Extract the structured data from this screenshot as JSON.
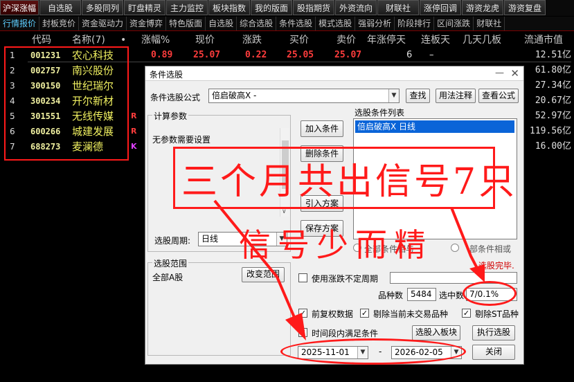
{
  "topbar": [
    "沪深涨幅",
    "自选股",
    "多股同列",
    "盯盘精灵",
    "主力监控",
    "板块指数",
    "我的版面",
    "股指期货",
    "外资流向",
    "财联社",
    "涨停回调",
    "游资龙虎",
    "游资复盘"
  ],
  "tabs": [
    "行情报价",
    "封板竞价",
    "资金驱动力",
    "资金博弈",
    "特色版面",
    "自选股",
    "综合选股",
    "条件选股",
    "模式选股",
    "强弱分析",
    "阶段排行",
    "区间涨跌",
    "财联社"
  ],
  "columns": {
    "code": "代码",
    "name": "名称(7)",
    "dot": "•",
    "chg": "涨幅%",
    "price": "现价",
    "diff": "涨跌",
    "buy": "买价",
    "sell": "卖价",
    "year_limit": "年涨停天",
    "consec": "连板天",
    "board": "几天几板",
    "mktval": "流通市值"
  },
  "stocks": [
    {
      "idx": "1",
      "code": "001231",
      "name": "农心科技",
      "chg": "0.89",
      "price": "25.07",
      "diff": "0.22",
      "buy": "25.05",
      "sell": "25.07",
      "year_limit": "6",
      "consec": "–",
      "mktval": "12.51亿",
      "tag": ""
    },
    {
      "idx": "2",
      "code": "002757",
      "name": "南兴股份",
      "mktval": "61.80亿",
      "tag": ""
    },
    {
      "idx": "3",
      "code": "300150",
      "name": "世纪瑞尔",
      "mktval": "27.34亿",
      "tag": ""
    },
    {
      "idx": "4",
      "code": "300234",
      "name": "开尔新材",
      "mktval": "20.67亿",
      "tag": ""
    },
    {
      "idx": "5",
      "code": "301551",
      "name": "无线传媒",
      "mktval": "52.97亿",
      "tag": "R"
    },
    {
      "idx": "6",
      "code": "600266",
      "name": "城建发展",
      "mktval": "119.56亿",
      "tag": "R"
    },
    {
      "idx": "7",
      "code": "688273",
      "name": "麦澜德",
      "mktval": "16.00亿",
      "tag": "K"
    }
  ],
  "dialog": {
    "title": "条件选股",
    "formula_label": "条件选股公式",
    "formula_value": "倍启破高X  -",
    "btn_find": "查找",
    "btn_usage": "用法注释",
    "btn_view": "查看公式",
    "params_group": "计算参数",
    "params_text": "无参数需要设置",
    "btn_add": "加入条件",
    "btn_delete": "删除条件",
    "btn_load": "引入方案",
    "btn_save": "保存方案",
    "list_label": "选股条件列表",
    "list_item": "倍启破高X  日线",
    "period_label": "选股周期:",
    "period_value": "日线",
    "radio_and": "全部条件相与",
    "radio_or": "部条件相或",
    "range_group": "选股范围",
    "range_value": "全部A股",
    "btn_range": "改变范围",
    "status": "选股完毕.",
    "chk_period": "使用涨跌不定周期",
    "count_label": "品种数",
    "count_value": "5484",
    "selected_label": "选中数",
    "selected_value": "7/0.1%",
    "chk_fq": "前复权数据",
    "chk_notrade": "剔除当前未交易品种",
    "chk_st": "剔除ST品种",
    "chk_time": "时间段内满足条件",
    "btn_toboard": "选股入板块",
    "btn_exec": "执行选股",
    "date_from": "2025-11-01",
    "date_sep": "-",
    "date_to": "2026-02-05",
    "btn_close": "关闭"
  },
  "annotation": {
    "headline": "三个月共出信号7只",
    "sub": "信号少而精"
  },
  "colors": {
    "accent_red": "#ff1a1a",
    "stock_name": "#f0f060",
    "select_blue": "#0a64d8"
  }
}
